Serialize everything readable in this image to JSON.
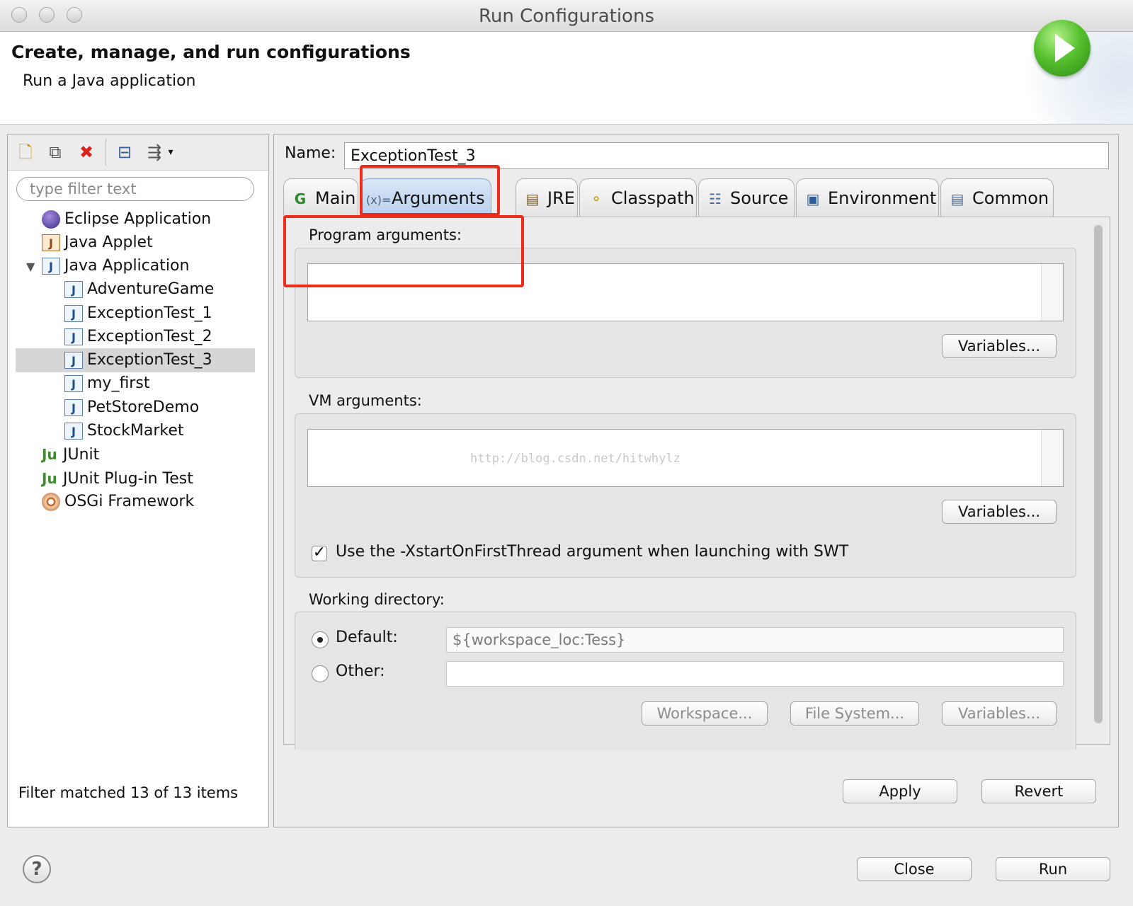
{
  "window": {
    "title": "Run Configurations"
  },
  "banner": {
    "title": "Create, manage, and run configurations",
    "subtitle": "Run a Java application"
  },
  "left": {
    "filter_placeholder": "type filter text",
    "tree": [
      {
        "label": "Eclipse Application"
      },
      {
        "label": "Java Applet"
      },
      {
        "label": "Java Application",
        "expanded": true
      },
      {
        "label": "AdventureGame"
      },
      {
        "label": "ExceptionTest_1"
      },
      {
        "label": "ExceptionTest_2"
      },
      {
        "label": "ExceptionTest_3",
        "selected": true
      },
      {
        "label": "my_first"
      },
      {
        "label": "PetStoreDemo"
      },
      {
        "label": "StockMarket"
      },
      {
        "label": "JUnit"
      },
      {
        "label": "JUnit Plug-in Test"
      },
      {
        "label": "OSGi Framework"
      }
    ],
    "status": "Filter matched 13 of 13 items"
  },
  "right": {
    "name_label": "Name:",
    "name_value": "ExceptionTest_3",
    "tabs": [
      {
        "label": "Main",
        "icon": "main-tab-icon"
      },
      {
        "label": "Arguments",
        "icon": "arguments-tab-icon",
        "active": true
      },
      {
        "label": "JRE",
        "icon": "jre-icon"
      },
      {
        "label": "Classpath",
        "icon": "classpath-icon"
      },
      {
        "label": "Source",
        "icon": "source-icon"
      },
      {
        "label": "Environment",
        "icon": "environment-icon"
      },
      {
        "label": "Common",
        "icon": "common-icon"
      }
    ],
    "program_args": {
      "label": "Program arguments:",
      "value": "",
      "variables_btn": "Variables..."
    },
    "vm_args": {
      "label": "VM arguments:",
      "value": "",
      "variables_btn": "Variables...",
      "watermark": "http://blog.csdn.net/hitwhylz"
    },
    "swt_checkbox": {
      "label": "Use the -XstartOnFirstThread argument when launching with SWT",
      "checked": true,
      "mark": "✓"
    },
    "working_dir": {
      "label": "Working directory:",
      "default_label": "Default:",
      "default_value": "${workspace_loc:Tess}",
      "other_label": "Other:",
      "other_value": "",
      "workspace_btn": "Workspace...",
      "filesystem_btn": "File System...",
      "variables_btn": "Variables..."
    },
    "apply_btn": "Apply",
    "revert_btn": "Revert"
  },
  "footer": {
    "help_icon": "?",
    "close_btn": "Close",
    "run_btn": "Run"
  },
  "colors": {
    "highlight": "#ee2a1a",
    "active_tab": "#b8cfee",
    "selection": "#d6d6d6"
  }
}
